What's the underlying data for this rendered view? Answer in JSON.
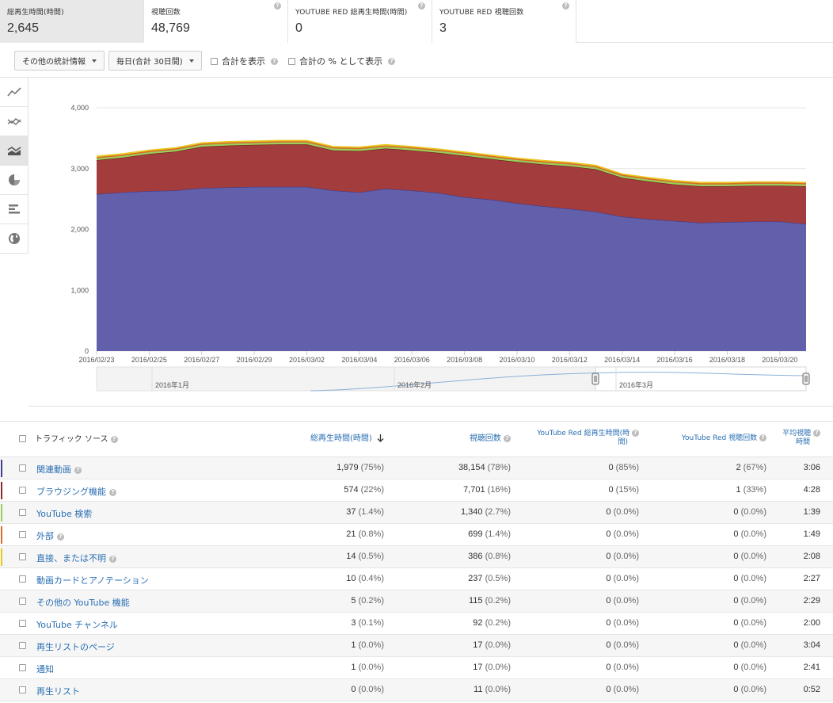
{
  "metrics": [
    {
      "label": "総再生時間(時間)",
      "value": "2,645"
    },
    {
      "label": "視聴回数",
      "value": "48,769"
    },
    {
      "label": "YOUTUBE RED 総再生時間(時間)",
      "value": "0"
    },
    {
      "label": "YOUTUBE RED 視聴回数",
      "value": "3"
    }
  ],
  "controls": {
    "more_stats": "その他の統計情報",
    "daily": "毎日(合計 30日間)",
    "show_total": "合計を表示",
    "show_percent": "合計の % として表示"
  },
  "rail_icons": [
    "line-chart-icon",
    "multi-line-chart-icon",
    "stacked-area-chart-icon",
    "pie-chart-icon",
    "bar-chart-icon",
    "globe-map-icon"
  ],
  "chart_data": {
    "type": "area",
    "stacked": true,
    "x": [
      "2016/02/23",
      "2016/02/24",
      "2016/02/25",
      "2016/02/26",
      "2016/02/27",
      "2016/02/28",
      "2016/02/29",
      "2016/03/01",
      "2016/03/02",
      "2016/03/03",
      "2016/03/04",
      "2016/03/05",
      "2016/03/06",
      "2016/03/07",
      "2016/03/08",
      "2016/03/09",
      "2016/03/10",
      "2016/03/11",
      "2016/03/12",
      "2016/03/13",
      "2016/03/14",
      "2016/03/15",
      "2016/03/16",
      "2016/03/17",
      "2016/03/18",
      "2016/03/19",
      "2016/03/20",
      "2016/03/21"
    ],
    "x_tick_labels": [
      "2016/02/23",
      "2016/02/25",
      "2016/02/27",
      "2016/02/29",
      "2016/03/02",
      "2016/03/04",
      "2016/03/06",
      "2016/03/08",
      "2016/03/10",
      "2016/03/12",
      "2016/03/14",
      "2016/03/16",
      "2016/03/18",
      "2016/03/20"
    ],
    "y_ticks": [
      "0",
      "1,000",
      "2,000",
      "3,000",
      "4,000"
    ],
    "ylim": [
      0,
      4000
    ],
    "grid": true,
    "series": [
      {
        "name": "関連動画",
        "color": "#6360ab",
        "values": [
          2580,
          2610,
          2630,
          2640,
          2680,
          2690,
          2700,
          2700,
          2700,
          2640,
          2610,
          2670,
          2640,
          2600,
          2530,
          2490,
          2430,
          2380,
          2340,
          2290,
          2210,
          2170,
          2140,
          2110,
          2120,
          2130,
          2130,
          2090
        ]
      },
      {
        "name": "ブラウジング機能",
        "color": "#a33c3c",
        "values": [
          560,
          570,
          610,
          640,
          680,
          690,
          690,
          700,
          700,
          660,
          680,
          660,
          660,
          660,
          680,
          670,
          680,
          690,
          700,
          700,
          640,
          620,
          600,
          600,
          590,
          590,
          590,
          620
        ]
      },
      {
        "name": "YouTube 検索",
        "color": "#9acd5a",
        "values": [
          30,
          30,
          30,
          30,
          30,
          30,
          30,
          30,
          30,
          30,
          30,
          30,
          30,
          30,
          30,
          30,
          30,
          30,
          30,
          30,
          30,
          30,
          30,
          30,
          30,
          30,
          30,
          30
        ]
      },
      {
        "name": "外部",
        "color": "#d96a2b",
        "values": [
          20,
          20,
          20,
          20,
          20,
          20,
          20,
          20,
          20,
          20,
          20,
          20,
          20,
          20,
          20,
          20,
          20,
          20,
          20,
          20,
          20,
          20,
          20,
          20,
          20,
          20,
          20,
          20
        ]
      },
      {
        "name": "直接、または不明",
        "color": "#e8c71e",
        "values": [
          15,
          15,
          15,
          15,
          15,
          15,
          15,
          15,
          15,
          15,
          15,
          15,
          15,
          15,
          15,
          15,
          15,
          15,
          15,
          15,
          15,
          15,
          15,
          15,
          15,
          15,
          15,
          15
        ]
      }
    ],
    "navigator_labels": [
      "2016年1月",
      "2016年2月",
      "2016年3月"
    ]
  },
  "table": {
    "headers": {
      "source": "トラフィック ソース",
      "watch_time": "総再生時間(時間)",
      "views": "視聴回数",
      "red_watch_time_l1": "YouTube Red 総再生時間(時",
      "red_watch_time_l2": "間)",
      "red_views": "YouTube Red 視聴回数",
      "avg_l1": "平均視聴",
      "avg_l2": "時間"
    },
    "rows": [
      {
        "name": "関連動画",
        "help": true,
        "color": "#3f3d8f",
        "watch": "1,979",
        "watch_pct": "(75%)",
        "views": "38,154",
        "views_pct": "(78%)",
        "red_watch": "0",
        "red_watch_pct": "(85%)",
        "red_views": "2",
        "red_views_pct": "(67%)",
        "avg": "3:06"
      },
      {
        "name": "ブラウジング機能",
        "help": true,
        "color": "#8b2a2a",
        "watch": "574",
        "watch_pct": "(22%)",
        "views": "7,701",
        "views_pct": "(16%)",
        "red_watch": "0",
        "red_watch_pct": "(15%)",
        "red_views": "1",
        "red_views_pct": "(33%)",
        "avg": "4:28"
      },
      {
        "name": "YouTube 検索",
        "help": false,
        "color": "#9acd5a",
        "watch": "37",
        "watch_pct": "(1.4%)",
        "views": "1,340",
        "views_pct": "(2.7%)",
        "red_watch": "0",
        "red_watch_pct": "(0.0%)",
        "red_views": "0",
        "red_views_pct": "(0.0%)",
        "avg": "1:39"
      },
      {
        "name": "外部",
        "help": true,
        "color": "#d96a2b",
        "watch": "21",
        "watch_pct": "(0.8%)",
        "views": "699",
        "views_pct": "(1.4%)",
        "red_watch": "0",
        "red_watch_pct": "(0.0%)",
        "red_views": "0",
        "red_views_pct": "(0.0%)",
        "avg": "1:49"
      },
      {
        "name": "直接、または不明",
        "help": true,
        "color": "#e8c71e",
        "watch": "14",
        "watch_pct": "(0.5%)",
        "views": "386",
        "views_pct": "(0.8%)",
        "red_watch": "0",
        "red_watch_pct": "(0.0%)",
        "red_views": "0",
        "red_views_pct": "(0.0%)",
        "avg": "2:08"
      },
      {
        "name": "動画カードとアノテーション",
        "help": false,
        "color": "",
        "watch": "10",
        "watch_pct": "(0.4%)",
        "views": "237",
        "views_pct": "(0.5%)",
        "red_watch": "0",
        "red_watch_pct": "(0.0%)",
        "red_views": "0",
        "red_views_pct": "(0.0%)",
        "avg": "2:27"
      },
      {
        "name": "その他の YouTube 機能",
        "help": false,
        "color": "",
        "watch": "5",
        "watch_pct": "(0.2%)",
        "views": "115",
        "views_pct": "(0.2%)",
        "red_watch": "0",
        "red_watch_pct": "(0.0%)",
        "red_views": "0",
        "red_views_pct": "(0.0%)",
        "avg": "2:29"
      },
      {
        "name": "YouTube チャンネル",
        "help": false,
        "color": "",
        "watch": "3",
        "watch_pct": "(0.1%)",
        "views": "92",
        "views_pct": "(0.2%)",
        "red_watch": "0",
        "red_watch_pct": "(0.0%)",
        "red_views": "0",
        "red_views_pct": "(0.0%)",
        "avg": "2:00"
      },
      {
        "name": "再生リストのページ",
        "help": false,
        "color": "",
        "watch": "1",
        "watch_pct": "(0.0%)",
        "views": "17",
        "views_pct": "(0.0%)",
        "red_watch": "0",
        "red_watch_pct": "(0.0%)",
        "red_views": "0",
        "red_views_pct": "(0.0%)",
        "avg": "3:04"
      },
      {
        "name": "通知",
        "help": false,
        "color": "",
        "watch": "1",
        "watch_pct": "(0.0%)",
        "views": "17",
        "views_pct": "(0.0%)",
        "red_watch": "0",
        "red_watch_pct": "(0.0%)",
        "red_views": "0",
        "red_views_pct": "(0.0%)",
        "avg": "2:41"
      },
      {
        "name": "再生リスト",
        "help": false,
        "color": "",
        "watch": "0",
        "watch_pct": "(0.0%)",
        "views": "11",
        "views_pct": "(0.0%)",
        "red_watch": "0",
        "red_watch_pct": "(0.0%)",
        "red_views": "0",
        "red_views_pct": "(0.0%)",
        "avg": "0:52"
      }
    ]
  }
}
